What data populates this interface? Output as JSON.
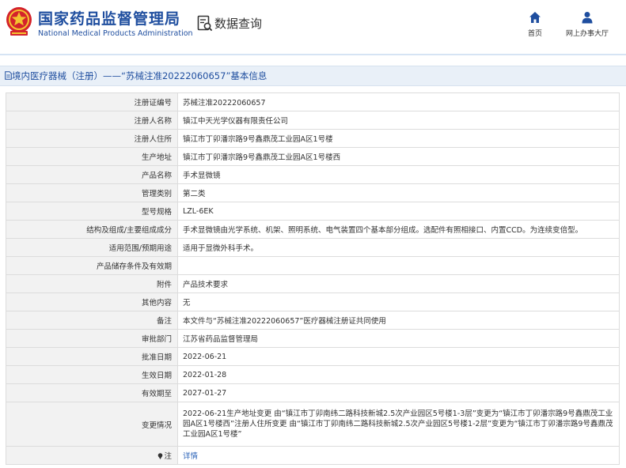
{
  "header": {
    "brand_cn": "国家药品监督管理局",
    "brand_en": "National Medical Products Administration",
    "query_title": "数据查询",
    "nav": [
      {
        "label": "首页",
        "icon": "home-icon"
      },
      {
        "label": "网上办事大厅",
        "icon": "user-icon"
      }
    ]
  },
  "section": {
    "title": "境内医疗器械（注册）——“苏械注准20222060657”基本信息"
  },
  "rows": [
    {
      "label": "注册证编号",
      "value": "苏械注准20222060657"
    },
    {
      "label": "注册人名称",
      "value": "镇江中天光学仪器有限责任公司"
    },
    {
      "label": "注册人住所",
      "value": "镇江市丁卯潘宗路9号鑫鼎茂工业园A区1号楼"
    },
    {
      "label": "生产地址",
      "value": "镇江市丁卯潘宗路9号鑫鼎茂工业园A区1号楼西"
    },
    {
      "label": "产品名称",
      "value": "手术显微镜"
    },
    {
      "label": "管理类别",
      "value": "第二类"
    },
    {
      "label": "型号规格",
      "value": "LZL-6EK"
    },
    {
      "label": "结构及组成/主要组成成分",
      "value": "手术显微镜由光学系统、机架、照明系统、电气装置四个基本部分组成。选配件有照相接口、内置CCD。为连续变倍型。"
    },
    {
      "label": "适用范围/预期用途",
      "value": "适用于显微外科手术。"
    },
    {
      "label": "产品储存条件及有效期",
      "value": ""
    },
    {
      "label": "附件",
      "value": "产品技术要求"
    },
    {
      "label": "其他内容",
      "value": "无"
    },
    {
      "label": "备注",
      "value": "本文件与“苏械注准20222060657”医疗器械注册证共同使用"
    },
    {
      "label": "审批部门",
      "value": "江苏省药品监督管理局"
    },
    {
      "label": "批准日期",
      "value": "2022-06-21"
    },
    {
      "label": "生效日期",
      "value": "2022-01-28"
    },
    {
      "label": "有效期至",
      "value": "2027-01-27"
    },
    {
      "label": "变更情况",
      "value": "2022-06-21生产地址变更 由“镇江市丁卯南纬二路科技新城2.5次产业园区5号楼1-3层”变更为“镇江市丁卯潘宗路9号鑫鼎茂工业园A区1号楼西”注册人住所变更 由“镇江市丁卯南纬二路科技新城2.5次产业园区5号楼1-2层”变更为“镇江市丁卯潘宗路9号鑫鼎茂工业园A区1号楼”"
    },
    {
      "label": "注",
      "value": "详情"
    }
  ],
  "colors": {
    "brand_blue": "#1f4e9f",
    "section_bg": "#e9f0f8",
    "label_bg": "#f2f2f2",
    "link": "#2a62b7"
  }
}
